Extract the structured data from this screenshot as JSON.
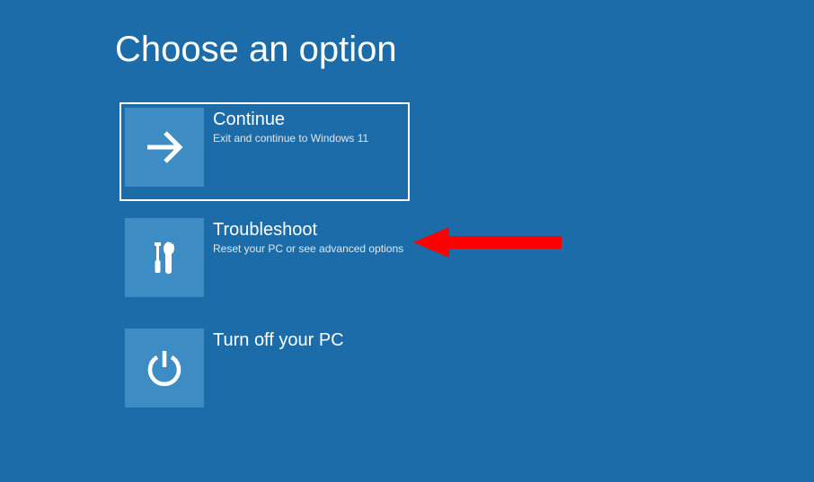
{
  "heading": "Choose an option",
  "options": {
    "continue": {
      "title": "Continue",
      "desc": "Exit and continue to Windows 11"
    },
    "troubleshoot": {
      "title": "Troubleshoot",
      "desc": "Reset your PC or see advanced options"
    },
    "turnoff": {
      "title": "Turn off your PC",
      "desc": ""
    }
  }
}
